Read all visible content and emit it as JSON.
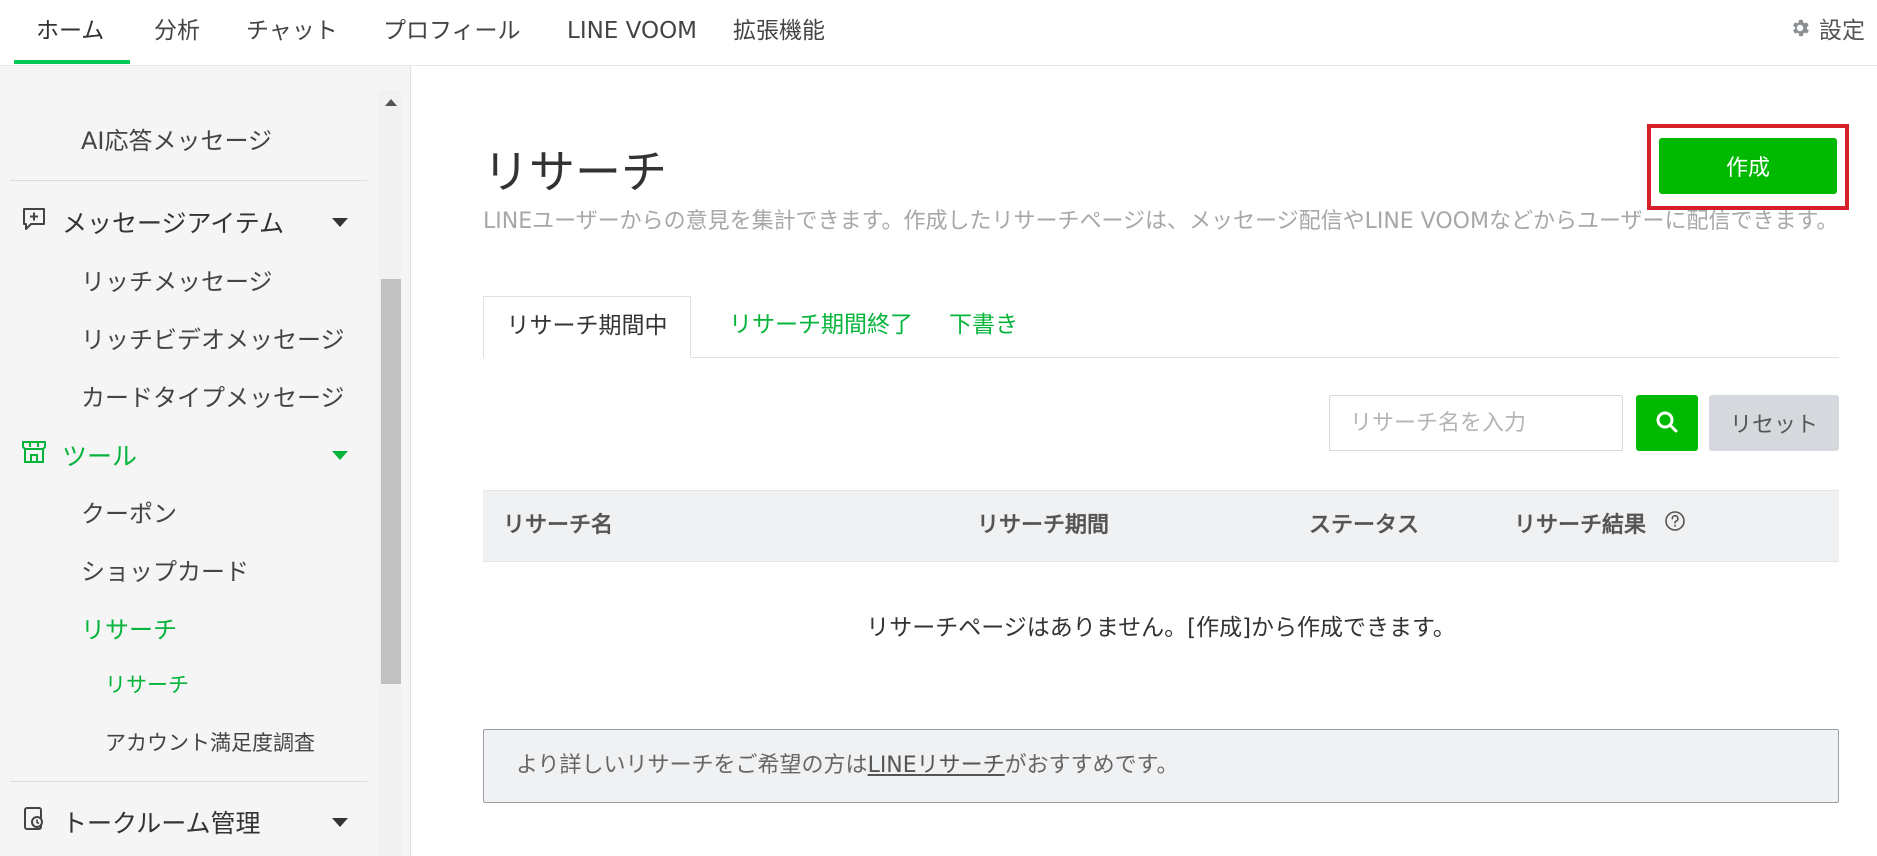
{
  "topnav": {
    "tabs": [
      {
        "label": "ホーム"
      },
      {
        "label": "分析"
      },
      {
        "label": "チャット"
      },
      {
        "label": "プロフィール"
      },
      {
        "label": "LINE VOOM"
      },
      {
        "label": "拡張機能"
      }
    ],
    "settings_label": "設定"
  },
  "sidebar": {
    "ai_message": "AI応答メッセージ",
    "message_items": {
      "label": "メッセージアイテム",
      "children": [
        "リッチメッセージ",
        "リッチビデオメッセージ",
        "カードタイプメッセージ"
      ]
    },
    "tools": {
      "label": "ツール",
      "children": [
        "クーポン",
        "ショップカード",
        "リサーチ"
      ],
      "research_children": [
        "リサーチ",
        "アカウント満足度調査"
      ]
    },
    "talkroom": {
      "label": "トークルーム管理"
    }
  },
  "main": {
    "title": "リサーチ",
    "description": "LINEユーザーからの意見を集計できます。作成したリサーチページは、メッセージ配信やLINE VOOMなどからユーザーに配信できます。",
    "create_button": "作成",
    "tabs": [
      "リサーチ期間中",
      "リサーチ期間終了",
      "下書き"
    ],
    "search": {
      "placeholder": "リサーチ名を入力",
      "value": ""
    },
    "reset_button": "リセット",
    "table": {
      "headers": [
        "リサーチ名",
        "リサーチ期間",
        "ステータス",
        "リサーチ結果"
      ],
      "empty_message": "リサーチページはありません。[作成]から作成できます。"
    },
    "notice": {
      "prefix": "より詳しいリサーチをご希望の方は",
      "link": "LINEリサーチ",
      "suffix": "がおすすめです。"
    }
  },
  "colors": {
    "accent": "#06c755",
    "button_green": "#00b900",
    "highlight": "#d5202a"
  },
  "icons": [
    "gear-icon",
    "message-item-icon",
    "tool-icon",
    "talkroom-icon",
    "search-icon",
    "help-circle-icon",
    "chevron-down-icon"
  ]
}
